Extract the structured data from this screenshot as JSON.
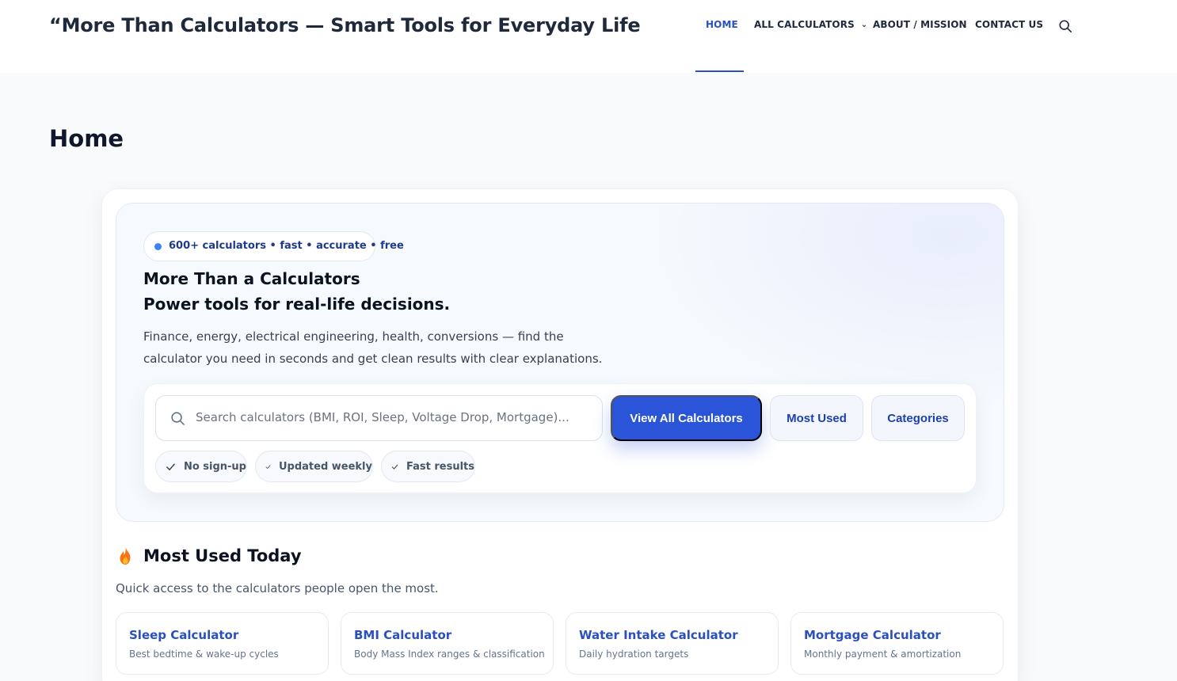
{
  "header": {
    "site_title": "“More Than Calculators — Smart Tools for Everyday Life",
    "nav": [
      {
        "label": "HOME"
      },
      {
        "label": "ALL CALCULATORS"
      },
      {
        "label": "ABOUT / MISSION"
      },
      {
        "label": "CONTACT US"
      }
    ],
    "search_icon": "search-icon",
    "dropdown_icon": "chevron-down-icon"
  },
  "page": {
    "title": "Home"
  },
  "hero": {
    "badge": "600+ calculators • fast • accurate • free",
    "headline_line1": "More Than a Calculators",
    "headline_line2": "Power tools for real-life decisions.",
    "description": "Finance, energy, electrical engineering, health, conversions — find the calculator you need in seconds and get clean results with clear explanations.",
    "search_placeholder": "Search calculators (BMI, ROI, Sleep, Voltage Drop, Mortgage)...",
    "buttons": {
      "view_all": "View All Calculators",
      "most_used": "Most Used",
      "categories": "Categories"
    },
    "chips": [
      "No sign-up",
      "Updated weekly",
      "Fast results"
    ]
  },
  "most_used": {
    "title": "Most Used Today",
    "icon": "flame-icon",
    "subtitle": "Quick access to the calculators people open the most.",
    "tiles": [
      {
        "title": "Sleep Calculator",
        "desc": "Best bedtime & wake-up cycles"
      },
      {
        "title": "BMI Calculator",
        "desc": "Body Mass Index ranges & classification"
      },
      {
        "title": "Water Intake Calculator",
        "desc": "Daily hydration targets"
      },
      {
        "title": "Mortgage Calculator",
        "desc": "Monthly payment & amortization"
      }
    ]
  },
  "colors": {
    "accent": "#2a55d8",
    "link": "#2a4fbf",
    "dot": "#3b82f6"
  }
}
